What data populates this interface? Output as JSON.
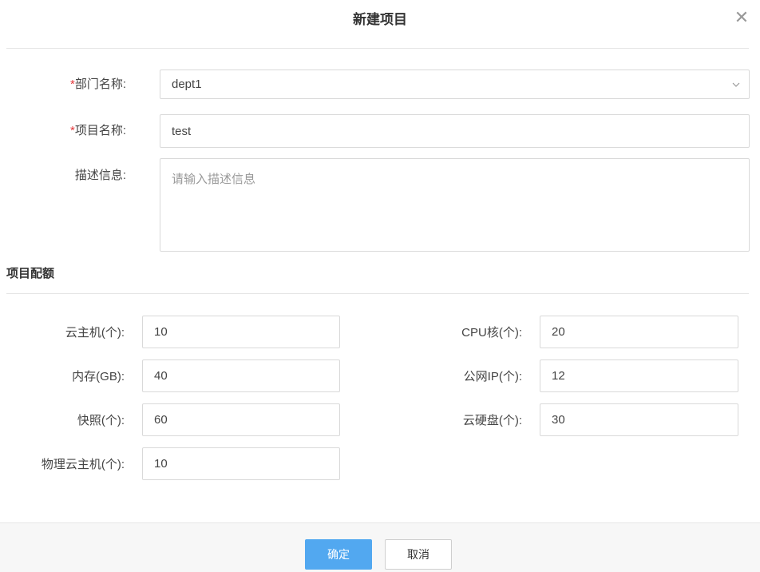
{
  "dialog": {
    "title": "新建项目",
    "close_symbol": "✕"
  },
  "form": {
    "required_mark": "*",
    "dept": {
      "label": "部门名称:",
      "value": "dept1"
    },
    "project": {
      "label": "项目名称:",
      "value": "test"
    },
    "description": {
      "label": "描述信息:",
      "placeholder": "请输入描述信息"
    }
  },
  "quota": {
    "section_title": "项目配额",
    "vm": {
      "label": "云主机(个):",
      "value": "10"
    },
    "cpu": {
      "label": "CPU核(个):",
      "value": "20"
    },
    "memory": {
      "label": "内存(GB):",
      "value": "40"
    },
    "public_ip": {
      "label": "公网IP(个):",
      "value": "12"
    },
    "snapshot": {
      "label": "快照(个):",
      "value": "60"
    },
    "cloud_disk": {
      "label": "云硬盘(个):",
      "value": "30"
    },
    "physical_vm": {
      "label": "物理云主机(个):",
      "value": "10"
    }
  },
  "footer": {
    "confirm_label": "确定",
    "cancel_label": "取消"
  },
  "colors": {
    "primary": "#52a8f0",
    "required": "#e4393c",
    "border": "#d9d9d9"
  },
  "icons": {
    "close": "close-icon",
    "dropdown": "chevron-down-icon"
  }
}
